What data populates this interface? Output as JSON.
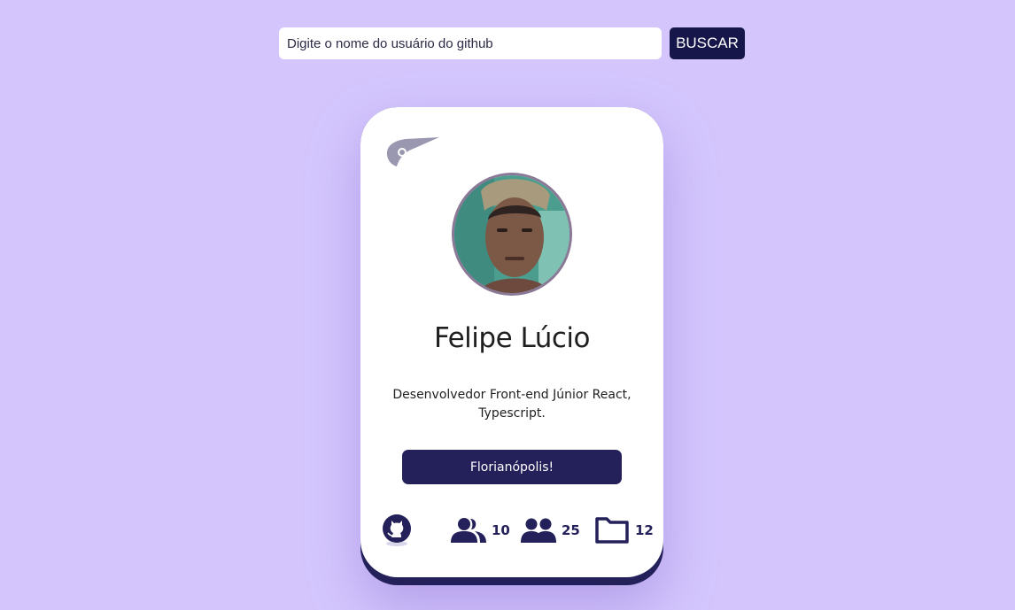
{
  "search": {
    "placeholder": "Digite o nome do usuário do github",
    "button_label": "BUSCAR"
  },
  "profile": {
    "name": "Felipe Lúcio",
    "bio": "Desenvolvedor Front-end Júnior React, Typescript.",
    "location": "Florianópolis!",
    "stats": {
      "followers": "10",
      "following": "25",
      "repositories": "12"
    }
  },
  "colors": {
    "background": "#d4c6fd",
    "accent": "#24205a",
    "button_dark": "#17164a"
  },
  "icons": {
    "logo": "brand-logo-icon",
    "github": "github-icon",
    "followers": "user-group-icon",
    "following": "users-icon",
    "repositories": "folder-icon"
  }
}
